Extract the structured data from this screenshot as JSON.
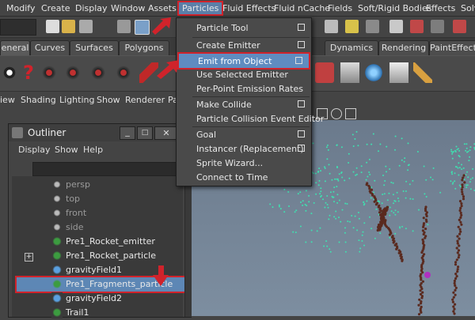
{
  "menubar": {
    "items": [
      "Modify",
      "Create",
      "Display",
      "Window",
      "Assets",
      "Particles",
      "Fluid Effects",
      "Fluid nCache",
      "Fields",
      "Soft/Rigid Bodies",
      "Effects",
      "Solv"
    ]
  },
  "shelf_tabs": [
    "eneral",
    "Curves",
    "Surfaces",
    "Polygons",
    "Dynamics",
    "Rendering",
    "PaintEffect"
  ],
  "panel_menu": [
    "iew",
    "Shading",
    "Lighting",
    "Show",
    "Renderer",
    "Par"
  ],
  "particles_menu": {
    "items": [
      "Particle Tool",
      "Create Emitter",
      "Emit from Object",
      "Use Selected Emitter",
      "Per-Point Emission Rates",
      "Make Collide",
      "Particle Collision Event Editor",
      "Goal",
      "Instancer (Replacement)",
      "Sprite Wizard...",
      "Connect to Time"
    ],
    "highlighted": "Emit from Object"
  },
  "outliner": {
    "title": "Outliner",
    "menu": [
      "Display",
      "Show",
      "Help"
    ],
    "items": [
      "persp",
      "top",
      "front",
      "side",
      "Pre1_Rocket_emitter",
      "Pre1_Rocket_particle",
      "gravityField1",
      "Pre1_Fragments_particle",
      "gravityField2",
      "Trail1"
    ],
    "selected": "Pre1_Fragments_particle",
    "window_controls": [
      "minimize",
      "maximize",
      "close"
    ]
  },
  "colors": {
    "highlight_red": "#d0232b",
    "selection_blue": "#5d87b5",
    "particle_cyan": "#3fe0b0",
    "particle_brown": "#5a2a1f"
  }
}
